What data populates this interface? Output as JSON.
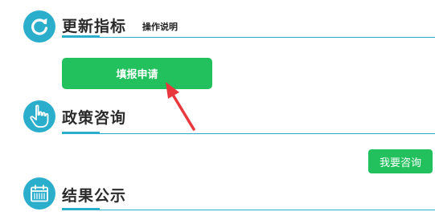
{
  "sections": [
    {
      "title": "更新指标",
      "icon": "refresh-icon",
      "help_link": "操作说明"
    },
    {
      "title": "政策咨询",
      "icon": "pointing-hand-icon"
    },
    {
      "title": "结果公示",
      "icon": "calendar-icon"
    }
  ],
  "buttons": {
    "apply_label": "填报申请",
    "consult_label": "我要咨询"
  },
  "annotation": {
    "arrow_color": "#e8383d",
    "icon": "red-arrow-annotation"
  },
  "colors": {
    "accent": "#2aaecb",
    "button_green": "#22c15e",
    "title_text": "#2b2b2b"
  }
}
